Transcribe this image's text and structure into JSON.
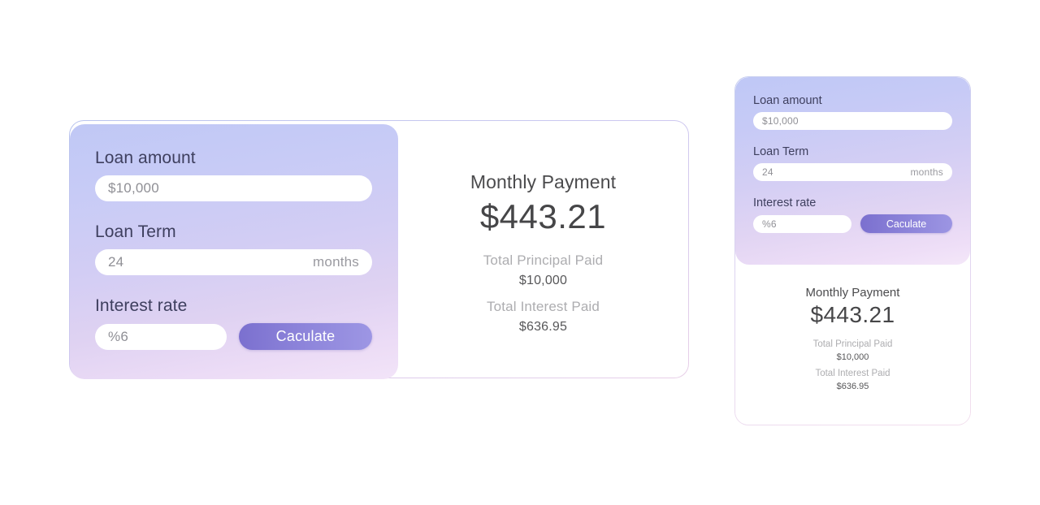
{
  "desktop": {
    "form": {
      "loan_amount": {
        "label": "Loan amount",
        "value": "$10,000",
        "placeholder": "$10,000"
      },
      "loan_term": {
        "label": "Loan Term",
        "value": "24",
        "placeholder": "24",
        "suffix": "months"
      },
      "interest_rate": {
        "label": "Interest rate",
        "value": "%6",
        "placeholder": "%6"
      },
      "calculate_button": "Caculate"
    },
    "results": {
      "monthly_payment_label": "Monthly Payment",
      "monthly_payment_value": "$443.21",
      "total_principal_label": "Total Principal Paid",
      "total_principal_value": "$10,000",
      "total_interest_label": "Total Interest Paid",
      "total_interest_value": "$636.95"
    }
  },
  "mobile": {
    "form": {
      "loan_amount": {
        "label": "Loan amount",
        "value": "$10,000",
        "placeholder": "$10,000"
      },
      "loan_term": {
        "label": "Loan Term",
        "value": "24",
        "placeholder": "24",
        "suffix": "months"
      },
      "interest_rate": {
        "label": "Interest rate",
        "value": "%6",
        "placeholder": "%6"
      },
      "calculate_button": "Caculate"
    },
    "results": {
      "monthly_payment_label": "Monthly Payment",
      "monthly_payment_value": "$443.21",
      "total_principal_label": "Total Principal Paid",
      "total_principal_value": "$10,000",
      "total_interest_label": "Total Interest Paid",
      "total_interest_value": "$636.95"
    }
  },
  "colors": {
    "form_gradient_start": "#c0c8f5",
    "form_gradient_end": "#f2e4f8",
    "button_gradient_start": "#7b70cf",
    "button_gradient_end": "#9d96e4",
    "label_text": "#3e3f5e",
    "result_title": "#4b4b4d",
    "result_muted": "#adadb0",
    "page_background": "#ffffff"
  }
}
